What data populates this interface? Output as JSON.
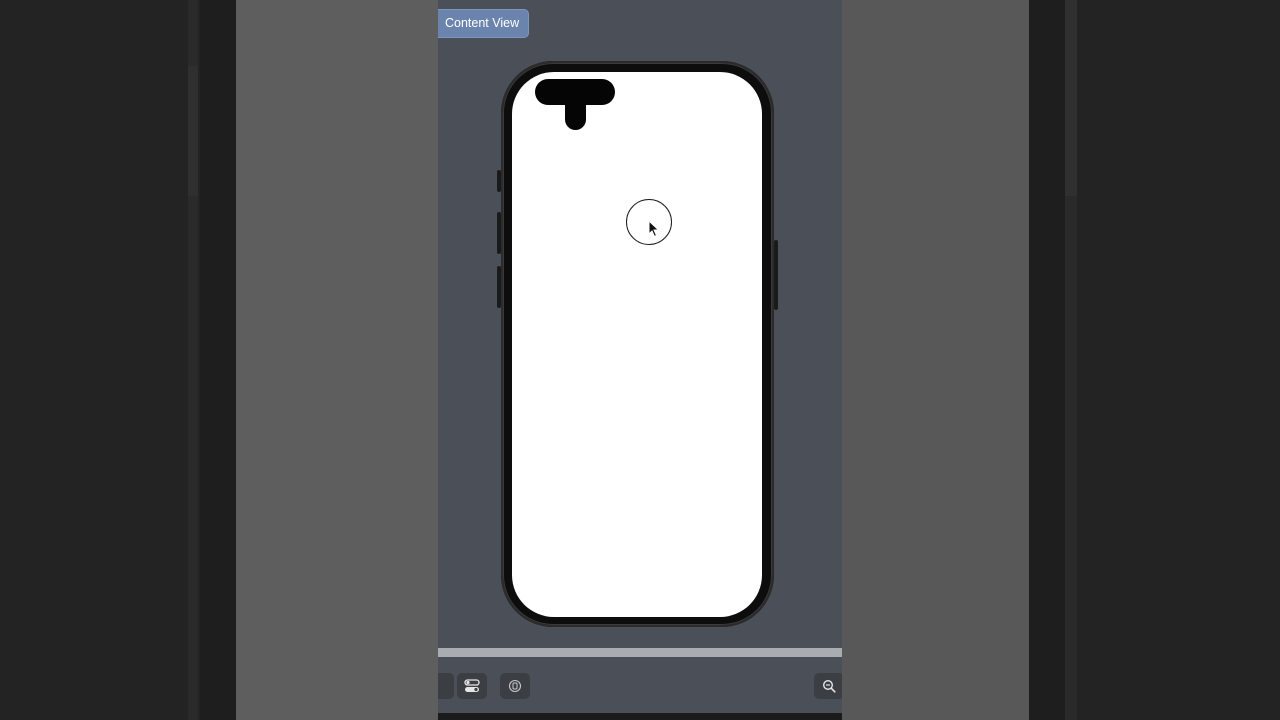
{
  "canvas": {
    "pill_label": "Content View",
    "colors": {
      "canvas_bg": "#4b5058",
      "pill_bg": "#6b84ad",
      "phone_body": "#0d0d0d",
      "screen": "#ffffff"
    }
  },
  "toolbar": {
    "buttons": [
      {
        "icon": "partial-button-icon"
      },
      {
        "icon": "variants-toggle-icon"
      },
      {
        "icon": "device-settings-icon"
      },
      {
        "icon": "zoom-out-icon"
      }
    ]
  }
}
